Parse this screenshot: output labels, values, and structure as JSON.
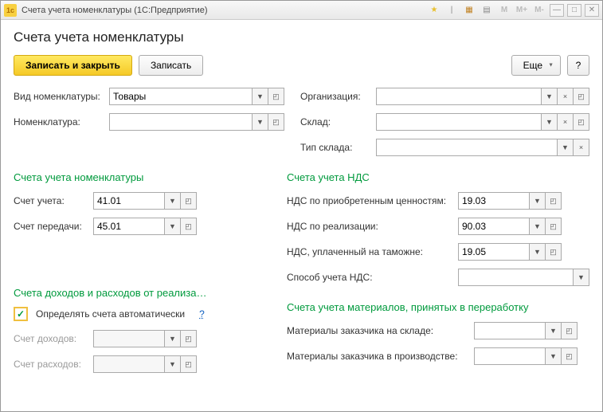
{
  "window": {
    "title": "Счета учета номенклатуры  (1С:Предприятие)"
  },
  "page_title": "Счета учета номенклатуры",
  "toolbar": {
    "save_close": "Записать и закрыть",
    "save": "Записать",
    "more": "Еще",
    "help": "?"
  },
  "top_left": {
    "kind_label": "Вид номенклатуры:",
    "kind_value": "Товары",
    "nomen_label": "Номенклатура:",
    "nomen_value": ""
  },
  "top_right": {
    "org_label": "Организация:",
    "org_value": "",
    "wh_label": "Склад:",
    "wh_value": "",
    "whtype_label": "Тип склада:",
    "whtype_value": ""
  },
  "accounts": {
    "title": "Счета учета номенклатуры",
    "acct_label": "Счет учета:",
    "acct_value": "41.01",
    "transfer_label": "Счет передачи:",
    "transfer_value": "45.01"
  },
  "vat": {
    "title": "Счета учета НДС",
    "purchased_label": "НДС по приобретенным ценностям:",
    "purchased_value": "19.03",
    "sales_label": "НДС по реализации:",
    "sales_value": "90.03",
    "customs_label": "НДС, уплаченный на таможне:",
    "customs_value": "19.05",
    "method_label": "Способ учета НДС:",
    "method_value": ""
  },
  "income": {
    "title": "Счета доходов и расходов от реализа…",
    "auto_label": "Определять счета автоматически",
    "help": "?",
    "income_label": "Счет доходов:",
    "income_value": "",
    "expense_label": "Счет расходов:",
    "expense_value": ""
  },
  "materials": {
    "title": "Счета учета материалов, принятых в переработку",
    "onwh_label": "Материалы заказчика на складе:",
    "onwh_value": "",
    "inprod_label": "Материалы заказчика в производстве:",
    "inprod_value": ""
  }
}
